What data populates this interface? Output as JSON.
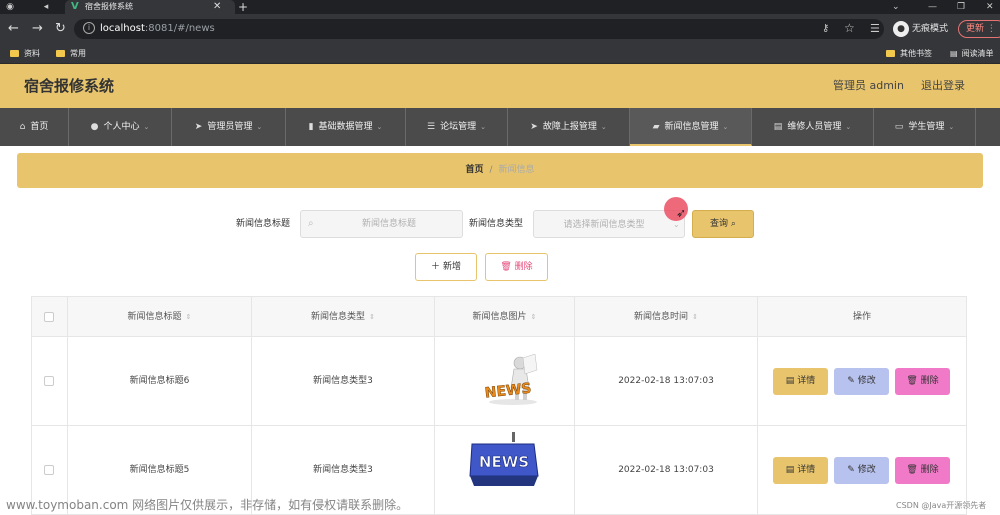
{
  "browser": {
    "tab_title": "宿舍报修系统",
    "url_host": "localhost",
    "url_rest": ":8081/#/news",
    "incognito_label": "无痕模式",
    "update_label": "更新",
    "bookmarks": [
      "资料",
      "常用"
    ],
    "bookmarks_right": [
      "其他书签",
      "阅读清单"
    ]
  },
  "header": {
    "title": "宿舍报修系统",
    "admin": "管理员 admin",
    "logout": "退出登录"
  },
  "menu": [
    {
      "label": "首页",
      "icon": "home-icon"
    },
    {
      "label": "个人中心",
      "icon": "user-icon"
    },
    {
      "label": "管理员管理",
      "icon": "send-icon"
    },
    {
      "label": "基础数据管理",
      "icon": "pin-icon"
    },
    {
      "label": "论坛管理",
      "icon": "sliders-icon"
    },
    {
      "label": "故障上报管理",
      "icon": "send-icon"
    },
    {
      "label": "新闻信息管理",
      "icon": "thumb-icon"
    },
    {
      "label": "维修人员管理",
      "icon": "printer-icon"
    },
    {
      "label": "学生管理",
      "icon": "monitor-icon"
    }
  ],
  "breadcrumb": {
    "home": "首页",
    "separator": "/",
    "current": "新闻信息"
  },
  "search": {
    "title_label": "新闻信息标题",
    "title_placeholder": "新闻信息标题",
    "type_label": "新闻信息类型",
    "type_placeholder": "请选择新闻信息类型",
    "query_label": "查询"
  },
  "actions": {
    "add": "新增",
    "delete": "删除"
  },
  "table": {
    "headers": [
      "新闻信息标题",
      "新闻信息类型",
      "新闻信息图片",
      "新闻信息时间",
      "操作"
    ],
    "rows": [
      {
        "title": "新闻信息标题6",
        "type": "新闻信息类型3",
        "image_text": "NEWS",
        "time": "2022-02-18 13:07:03"
      },
      {
        "title": "新闻信息标题5",
        "type": "新闻信息类型3",
        "image_text": "NEWS",
        "time": "2022-02-18 13:07:03"
      }
    ],
    "ops": {
      "detail": "详情",
      "edit": "修改",
      "delete": "删除"
    }
  },
  "watermark": {
    "left": "www.toymoban.com 网络图片仅供展示，非存储，如有侵权请联系删除。",
    "right": "CSDN @Java开源领先者"
  },
  "colors": {
    "accent": "#e8c56d",
    "menu_bg": "#4b4b4b",
    "edit_btn": "#b8c2ee",
    "delete_btn": "#f07ac8"
  }
}
